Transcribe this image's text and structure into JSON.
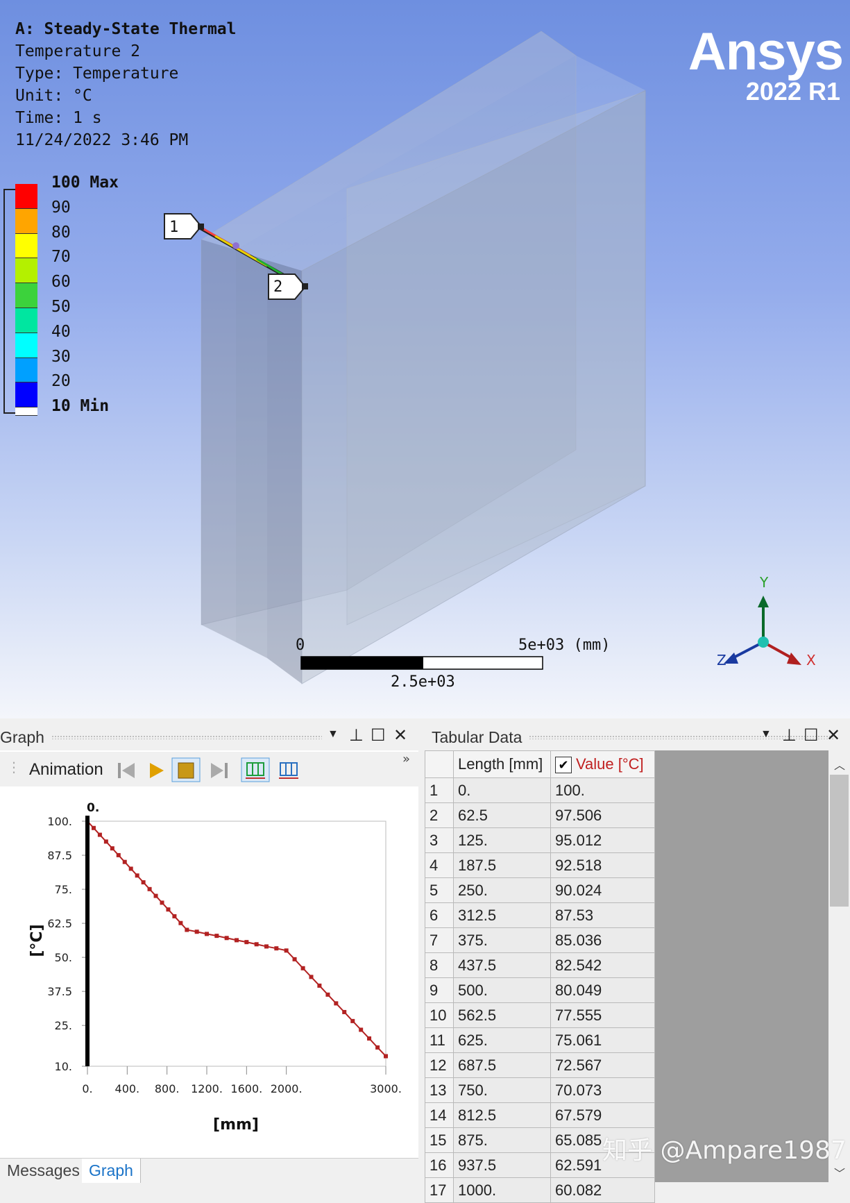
{
  "viewport": {
    "info": {
      "analysis": "A: Steady-State Thermal",
      "result": "Temperature 2",
      "type": "Type: Temperature",
      "unit": "Unit: °C",
      "time": "Time: 1 s",
      "date": "11/24/2022 3:46 PM"
    },
    "legend": {
      "labels": [
        "100 Max",
        "90",
        "80",
        "70",
        "60",
        "50",
        "40",
        "30",
        "20",
        "10 Min"
      ],
      "colors": [
        "#ff0000",
        "#ffa500",
        "#ffff00",
        "#b4f000",
        "#3cd23c",
        "#00e6a0",
        "#00ffff",
        "#00a0ff",
        "#0000ff",
        "#ffffff"
      ]
    },
    "logo": {
      "brand": "Ansys",
      "version": "2022 R1"
    },
    "probes": [
      "1",
      "2"
    ],
    "scale": {
      "left": "0",
      "right": "5e+03 (mm)",
      "mid": "2.5e+03"
    },
    "triad": {
      "x": "X",
      "y": "Y",
      "z": "Z"
    },
    "watermark": "知乎 @Ampare1987"
  },
  "graph_panel": {
    "title": "Graph",
    "animation_label": "Animation",
    "tabs": [
      "Messages",
      "Graph"
    ]
  },
  "chart_data": {
    "type": "line",
    "marker_label": "0.",
    "xlabel": "[mm]",
    "ylabel": "[°C]",
    "xlim": [
      0,
      3000
    ],
    "ylim": [
      10,
      100
    ],
    "x_ticks": [
      "0.",
      "400.",
      "800.",
      "1200.",
      "1600.",
      "2000.",
      "3000."
    ],
    "x_tick_values": [
      0,
      400,
      800,
      1200,
      1600,
      2000,
      3000
    ],
    "y_ticks": [
      "100.",
      "87.5",
      "75.",
      "62.5",
      "50.",
      "37.5",
      "25.",
      "10."
    ],
    "y_tick_values": [
      100,
      87.5,
      75,
      62.5,
      50,
      37.5,
      25,
      10
    ],
    "series": [
      {
        "color": "#b22222",
        "x": [
          0,
          62.5,
          125,
          187.5,
          250,
          312.5,
          375,
          437.5,
          500,
          562.5,
          625,
          687.5,
          750,
          812.5,
          875,
          937.5,
          1000,
          1100,
          1200,
          1300,
          1400,
          1500,
          1600,
          1700,
          1800,
          1900,
          2000,
          2083,
          2167,
          2250,
          2333,
          2417,
          2500,
          2583,
          2667,
          2750,
          2833,
          2917,
          3000
        ],
        "y": [
          100,
          97.506,
          95.012,
          92.518,
          90.024,
          87.53,
          85.036,
          82.542,
          80.049,
          77.555,
          75.061,
          72.567,
          70.073,
          67.579,
          65.085,
          62.591,
          60.097,
          59.4,
          58.6,
          57.9,
          57.1,
          56.3,
          55.6,
          54.8,
          54.0,
          53.3,
          52.5,
          49.3,
          46.0,
          42.8,
          39.6,
          36.3,
          33.1,
          29.9,
          26.6,
          23.4,
          20.2,
          16.9,
          13.7
        ]
      }
    ]
  },
  "table_panel": {
    "title": "Tabular Data",
    "headers": [
      "Length [mm]",
      "Value [°C]"
    ],
    "rows": [
      [
        "1",
        "0.",
        "100."
      ],
      [
        "2",
        "62.5",
        "97.506"
      ],
      [
        "3",
        "125.",
        "95.012"
      ],
      [
        "4",
        "187.5",
        "92.518"
      ],
      [
        "5",
        "250.",
        "90.024"
      ],
      [
        "6",
        "312.5",
        "87.53"
      ],
      [
        "7",
        "375.",
        "85.036"
      ],
      [
        "8",
        "437.5",
        "82.542"
      ],
      [
        "9",
        "500.",
        "80.049"
      ],
      [
        "10",
        "562.5",
        "77.555"
      ],
      [
        "11",
        "625.",
        "75.061"
      ],
      [
        "12",
        "687.5",
        "72.567"
      ],
      [
        "13",
        "750.",
        "70.073"
      ],
      [
        "14",
        "812.5",
        "67.579"
      ],
      [
        "15",
        "875.",
        "65.085"
      ],
      [
        "16",
        "937.5",
        "62.591"
      ],
      [
        "17",
        "1000.",
        "60.082"
      ]
    ]
  }
}
